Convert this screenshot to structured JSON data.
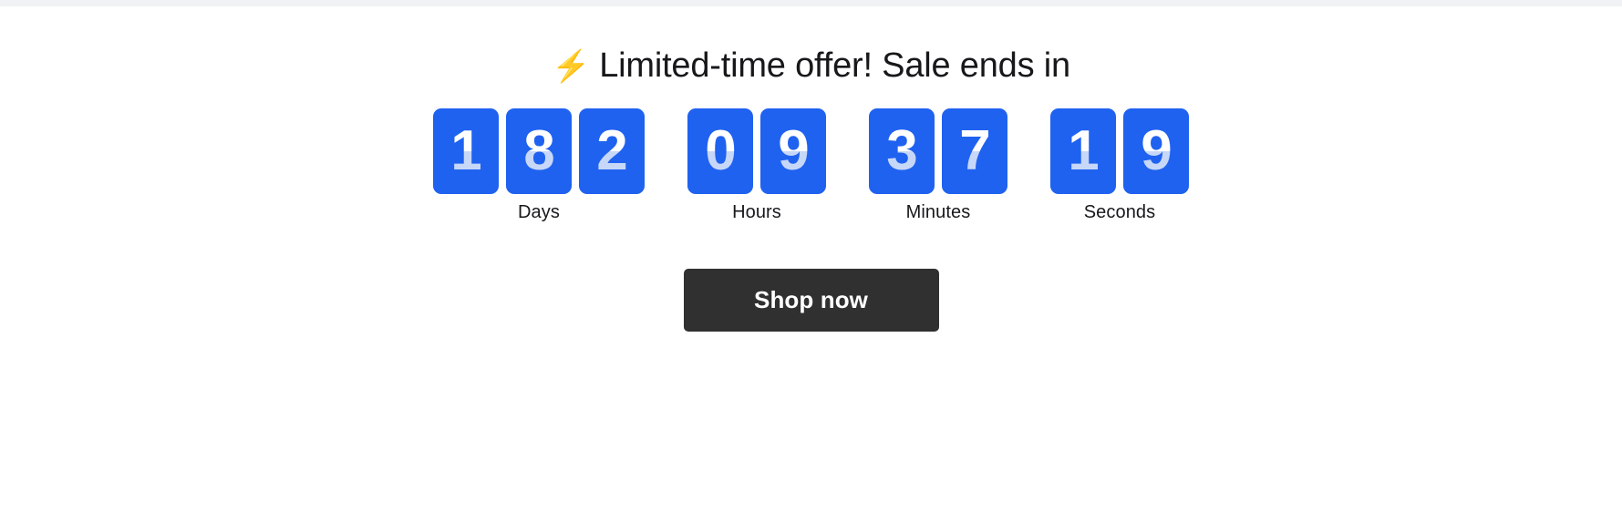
{
  "banner": {
    "headline_icon": "high-voltage-icon",
    "headline_icon_glyph": "⚡",
    "headline_text": "Limited-time offer! Sale ends in",
    "accent_color": "#1f62f0",
    "digit_top_color": "#ffffff",
    "digit_bottom_color": "#c7d7f8",
    "cta_color": "#303030",
    "background_color": "#ffffff"
  },
  "countdown": {
    "units": [
      {
        "label": "Days",
        "value": "182",
        "digits": [
          "1",
          "8",
          "2"
        ]
      },
      {
        "label": "Hours",
        "value": "09",
        "digits": [
          "0",
          "9"
        ]
      },
      {
        "label": "Minutes",
        "value": "37",
        "digits": [
          "3",
          "7"
        ]
      },
      {
        "label": "Seconds",
        "value": "19",
        "digits": [
          "1",
          "9"
        ]
      }
    ]
  },
  "cta": {
    "label": "Shop now"
  }
}
